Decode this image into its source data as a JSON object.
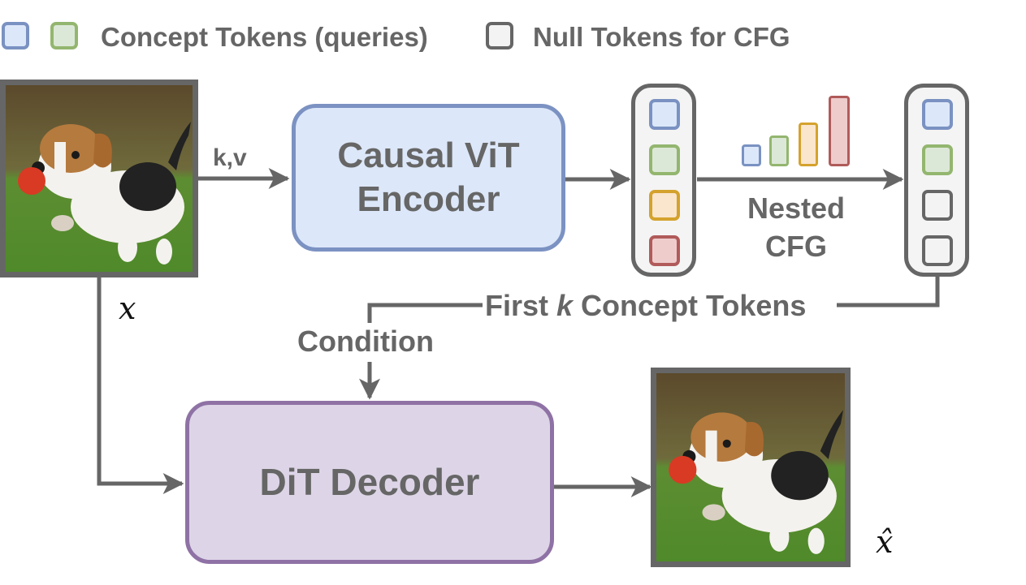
{
  "legend": {
    "concept_label": "Concept Tokens (queries)",
    "null_label": "Null Tokens for CFG"
  },
  "colors": {
    "line": "#666666",
    "blue": {
      "stroke": "#7a92c2",
      "fill": "#dce7f9"
    },
    "green": {
      "stroke": "#93b66f",
      "fill": "#dce8d7"
    },
    "orange": {
      "stroke": "#d4a22d",
      "fill": "#fae5cd"
    },
    "red": {
      "stroke": "#b05b5a",
      "fill": "#efcccc"
    },
    "gray": {
      "stroke": "#666666",
      "fill": "#f3f3f3"
    },
    "encoder": {
      "stroke": "#7b92c2",
      "fill": "#dce7f9"
    },
    "decoder": {
      "stroke": "#8f72a5",
      "fill": "#ddd5e7"
    }
  },
  "nodes": {
    "input_image_alt": "Beagle puppy running on grass with red ball",
    "output_image_alt": "Reconstructed beagle puppy running on grass with red ball",
    "encoder_line1": "Causal ViT",
    "encoder_line2": "Encoder",
    "decoder_label": "DiT Decoder"
  },
  "tokens": {
    "encoded_column": [
      "blue",
      "green",
      "orange",
      "red"
    ],
    "nested_column": [
      "blue",
      "green",
      "gray",
      "gray"
    ]
  },
  "cfg_strength_bars": [
    {
      "color": "blue",
      "relative": 0.29
    },
    {
      "color": "green",
      "relative": 0.43
    },
    {
      "color": "orange",
      "relative": 0.61
    },
    {
      "color": "red",
      "relative": 1.0
    }
  ],
  "labels": {
    "kv": "k,v",
    "nested_line1": "Nested",
    "nested_line2": "CFG",
    "first_prefix": "First ",
    "first_k": "k",
    "first_suffix": " Concept Tokens",
    "condition": "Condition",
    "x": "x",
    "x_hat": "x̂"
  }
}
